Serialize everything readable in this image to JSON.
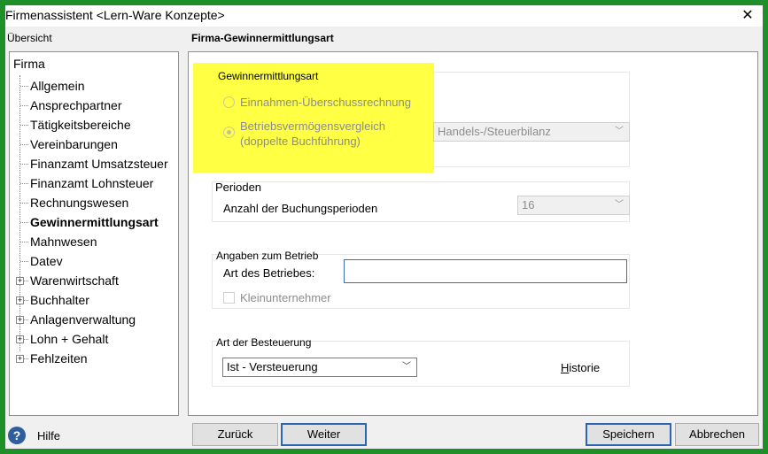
{
  "window": {
    "title": "Firmenassistent <Lern-Ware Konzepte>",
    "close_icon": "close-icon"
  },
  "left": {
    "header": "Übersicht",
    "root": "Firma",
    "items": [
      {
        "label": "Allgemein",
        "expandable": false
      },
      {
        "label": "Ansprechpartner",
        "expandable": false
      },
      {
        "label": "Tätigkeitsbereiche",
        "expandable": false
      },
      {
        "label": "Vereinbarungen",
        "expandable": false
      },
      {
        "label": "Finanzamt Umsatzsteuer",
        "expandable": false
      },
      {
        "label": "Finanzamt Lohnsteuer",
        "expandable": false
      },
      {
        "label": "Rechnungswesen",
        "expandable": false
      },
      {
        "label": "Gewinnermittlungsart",
        "expandable": false,
        "selected": true
      },
      {
        "label": "Mahnwesen",
        "expandable": false
      },
      {
        "label": "Datev",
        "expandable": false
      },
      {
        "label": "Warenwirtschaft",
        "expandable": true
      },
      {
        "label": "Buchhalter",
        "expandable": true
      },
      {
        "label": "Anlagenverwaltung",
        "expandable": true
      },
      {
        "label": "Lohn + Gehalt",
        "expandable": true
      },
      {
        "label": "Fehlzeiten",
        "expandable": true
      }
    ]
  },
  "right": {
    "header": "Firma-Gewinnermittlungsart",
    "gewinn": {
      "title": "Gewinnermittlungsart",
      "option1": "Einnahmen-Überschussrechnung",
      "option2_line1": "Betriebsvermögensvergleich",
      "option2_line2": "(doppelte Buchführung)",
      "bilanz_value": "Handels-/Steuerbilanz"
    },
    "perioden": {
      "title": "Perioden",
      "label": "Anzahl der Buchungsperioden",
      "value": "16"
    },
    "betrieb": {
      "title": "Angaben zum Betrieb",
      "art_label": "Art des Betriebes:",
      "art_value": "",
      "klein_label": "Kleinunternehmer"
    },
    "besteuerung": {
      "title": "Art der Besteuerung",
      "value": "Ist - Versteuerung",
      "historie_prefix": "H",
      "historie_rest": "istorie"
    }
  },
  "footer": {
    "help_label": "Hilfe",
    "back": "Zurück",
    "next": "Weiter",
    "save": "Speichern",
    "cancel": "Abbrechen"
  },
  "colors": {
    "highlight": "#ffff44",
    "frame": "#1f8f2a",
    "focus_border": "#2b66b3"
  }
}
